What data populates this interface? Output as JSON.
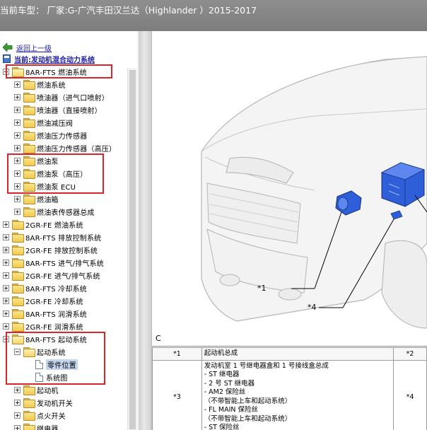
{
  "window": {
    "title": "当前车型：  厂家:G-广汽丰田汉兰达（Highlander ）2015-2017"
  },
  "nav": {
    "back_label": "返回上一级",
    "current_label": "当前:发动机混合动力系统"
  },
  "tree": {
    "items": [
      {
        "label": "8AR-FTS 燃油系统",
        "state": "open",
        "level": 0
      },
      {
        "label": "燃油系统",
        "state": "collapsed",
        "level": 1
      },
      {
        "label": "喷油器（进气口喷射）",
        "state": "collapsed",
        "level": 1
      },
      {
        "label": "喷油器（直接喷射）",
        "state": "collapsed",
        "level": 1
      },
      {
        "label": "燃油减压阀",
        "state": "collapsed",
        "level": 1
      },
      {
        "label": "燃油压力传感器",
        "state": "collapsed",
        "level": 1
      },
      {
        "label": "燃油压力传感器（高压）",
        "state": "collapsed",
        "level": 1
      },
      {
        "label": "燃油泵",
        "state": "collapsed",
        "level": 1
      },
      {
        "label": "燃油泵（高压）",
        "state": "collapsed",
        "level": 1
      },
      {
        "label": "燃油泵 ECU",
        "state": "collapsed",
        "level": 1
      },
      {
        "label": "燃油箱",
        "state": "collapsed",
        "level": 1
      },
      {
        "label": "燃油表传感器总成",
        "state": "collapsed",
        "level": 1
      },
      {
        "label": "2GR-FE 燃油系统",
        "state": "collapsed",
        "level": 0
      },
      {
        "label": "8AR-FTS 排放控制系统",
        "state": "collapsed",
        "level": 0
      },
      {
        "label": "2GR-FE 排放控制系统",
        "state": "collapsed",
        "level": 0
      },
      {
        "label": "8AR-FTS 进气/排气系统",
        "state": "collapsed",
        "level": 0
      },
      {
        "label": "2GR-FE 进气/排气系统",
        "state": "collapsed",
        "level": 0
      },
      {
        "label": "8AR-FTS 冷却系统",
        "state": "collapsed",
        "level": 0
      },
      {
        "label": "2GR-FE 冷却系统",
        "state": "collapsed",
        "level": 0
      },
      {
        "label": "8AR-FTS 润滑系统",
        "state": "collapsed",
        "level": 0
      },
      {
        "label": "2GR-FE 润滑系统",
        "state": "collapsed",
        "level": 0
      },
      {
        "label": "8AR-FTS 起动系统",
        "state": "open",
        "level": 0
      },
      {
        "label": "起动系统",
        "state": "open",
        "level": 1
      },
      {
        "label": "零件位置",
        "state": "doc",
        "level": 2,
        "selected": true
      },
      {
        "label": "系统图",
        "state": "doc",
        "level": 2
      },
      {
        "label": "起动机",
        "state": "collapsed",
        "level": 1
      },
      {
        "label": "发动机开关",
        "state": "collapsed",
        "level": 1
      },
      {
        "label": "点火开关",
        "state": "collapsed",
        "level": 1
      },
      {
        "label": "继电器",
        "state": "collapsed",
        "level": 1
      }
    ]
  },
  "figure": {
    "callouts": [
      "*1",
      "*4"
    ],
    "label": "C"
  },
  "parts_table": {
    "rows": [
      {
        "id": "*1",
        "desc": [
          "起动机总成"
        ],
        "id2": "*2"
      },
      {
        "id": "*3",
        "desc": [
          "发动机室 1 号继电器盒和 1 号接线盒总成",
          "- ST 继电器",
          "- 2 号 ST 继电器",
          "- AM2 保险丝",
          "（不带智能上车和起动系统）",
          "- FL MAIN 保险丝",
          "（不带智能上车和起动系统）",
          "- ST 保险丝"
        ],
        "id2": "*4"
      }
    ]
  },
  "colors": {
    "titlebar": "#7d7d7d",
    "highlight_box": "#d9262c",
    "link": "#1a1aa6",
    "component_blue": "#2f5fd8"
  }
}
